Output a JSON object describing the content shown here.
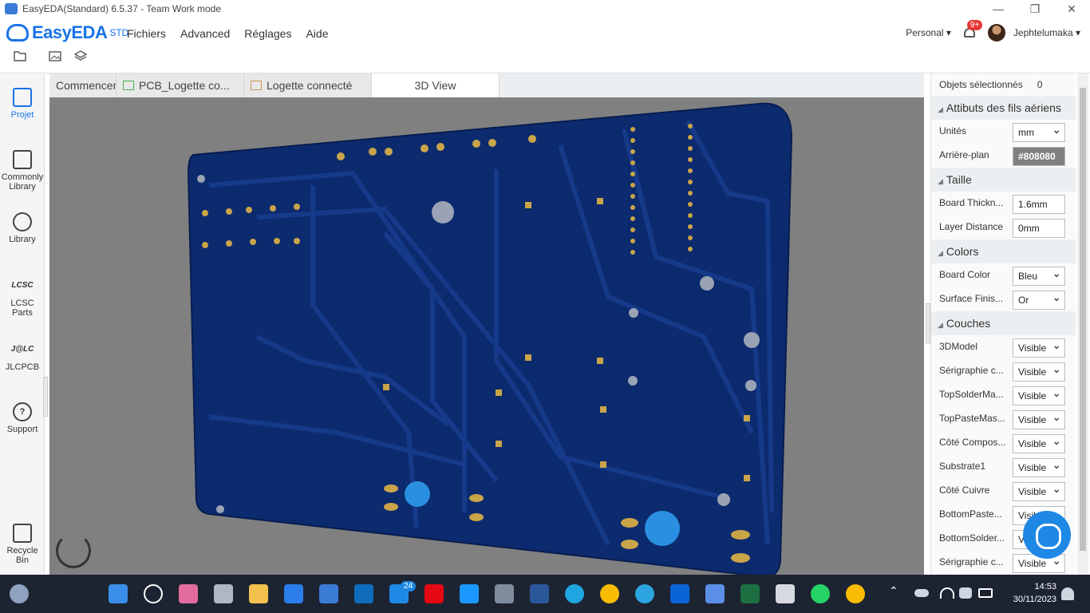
{
  "window": {
    "title": "EasyEDA(Standard) 6.5.37 - Team Work mode",
    "controls": [
      "—",
      "❐",
      "✕"
    ]
  },
  "brand": {
    "name": "EasyEDA",
    "edition": "STD"
  },
  "menu": [
    "Fichiers",
    "Advanced",
    "Réglages",
    "Aide"
  ],
  "account": {
    "mode": "Personal",
    "notifications": "9+",
    "username": "Jephtelumaka"
  },
  "sidebar": [
    {
      "label": "Projet",
      "icon": "folder-icon",
      "active": true
    },
    {
      "label": "Commonly Library",
      "icon": "chip-icon"
    },
    {
      "label": "Library",
      "icon": "search-icon"
    },
    {
      "label": "LCSC Parts",
      "icon": "lcsc-logo-icon",
      "mark": "LCSC"
    },
    {
      "label": "JLCPCB",
      "icon": "jlc-logo-icon",
      "mark": "J@LC"
    },
    {
      "label": "Support",
      "icon": "help-icon",
      "mark": "?"
    },
    {
      "label": "Recycle Bin",
      "icon": "trash-icon"
    }
  ],
  "tabs": [
    {
      "label": "Commencer",
      "icon": null
    },
    {
      "label": "PCB_Logette co...",
      "icon": "pcb-icon"
    },
    {
      "label": "Logette connecté",
      "icon": "folder-icon"
    },
    {
      "label": "3D View",
      "icon": null,
      "active": true
    }
  ],
  "panel": {
    "selected_label": "Objets sélectionnés",
    "selected_count": "0",
    "sections": [
      {
        "title": "Attibuts des fils aériens",
        "rows": [
          {
            "label": "Unités",
            "value": "mm",
            "type": "select"
          },
          {
            "label": "Arrière-plan",
            "value": "#808080",
            "type": "color"
          }
        ]
      },
      {
        "title": "Taille",
        "rows": [
          {
            "label": "Board Thickn...",
            "value": "1.6mm",
            "type": "input"
          },
          {
            "label": "Layer Distance",
            "value": "0mm",
            "type": "input"
          }
        ]
      },
      {
        "title": "Colors",
        "rows": [
          {
            "label": "Board Color",
            "value": "Bleu",
            "type": "select"
          },
          {
            "label": "Surface Finis...",
            "value": "Or",
            "type": "select"
          }
        ]
      },
      {
        "title": "Couches",
        "rows": [
          {
            "label": "3DModel",
            "value": "Visible",
            "type": "select"
          },
          {
            "label": "Sérigraphie c...",
            "value": "Visible",
            "type": "select"
          },
          {
            "label": "TopSolderMa...",
            "value": "Visible",
            "type": "select"
          },
          {
            "label": "TopPasteMas...",
            "value": "Visible",
            "type": "select"
          },
          {
            "label": "Côté Compos...",
            "value": "Visible",
            "type": "select"
          },
          {
            "label": "Substrate1",
            "value": "Visible",
            "type": "select"
          },
          {
            "label": "Côté Cuivre",
            "value": "Visible",
            "type": "select"
          },
          {
            "label": "BottomPaste...",
            "value": "Visible",
            "type": "select"
          },
          {
            "label": "BottomSolder...",
            "value": "Visible",
            "type": "select"
          },
          {
            "label": "Sérigraphie c...",
            "value": "Visible",
            "type": "select"
          }
        ]
      }
    ]
  },
  "colors": {
    "accent": "#1a73e8",
    "board": "#0c2a6e",
    "trace": "#163a8a",
    "pad": "#c9a449",
    "viewport_bg": "#808080",
    "taskbar": "#1c2331"
  },
  "taskbar": {
    "time": "14:53",
    "date": "30/11/2023",
    "outlook_badge": "24"
  }
}
